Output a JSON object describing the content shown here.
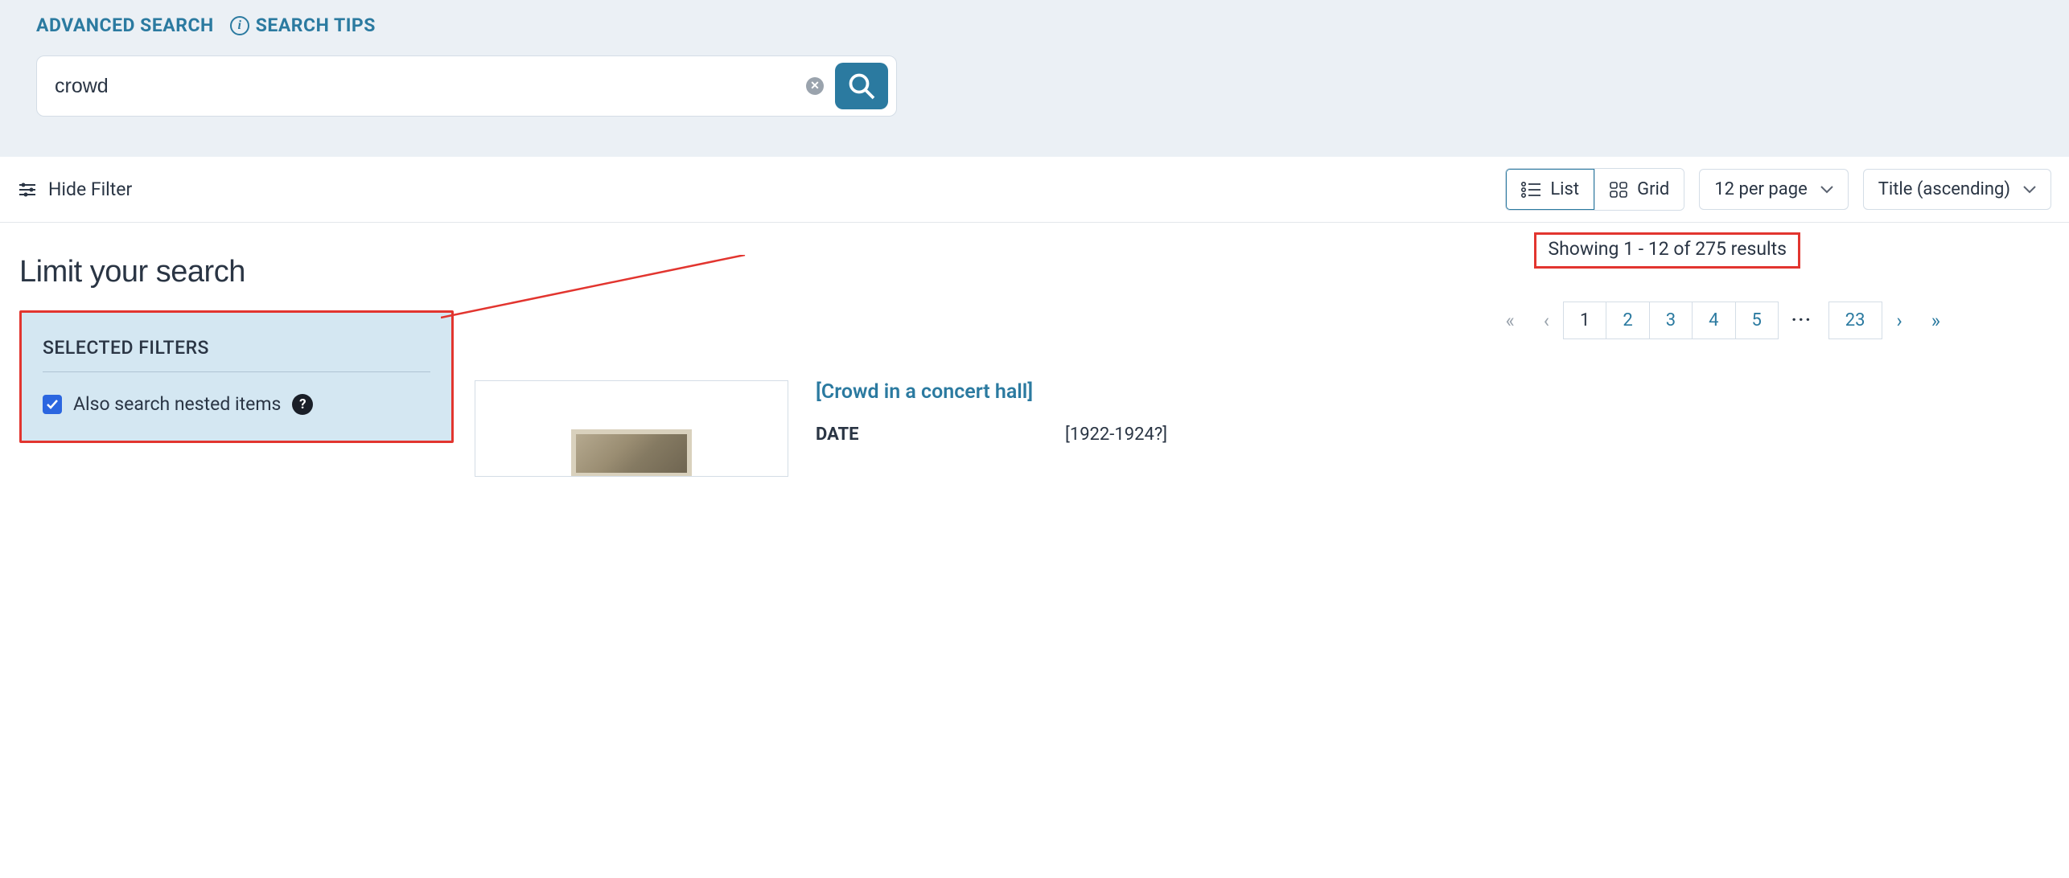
{
  "header": {
    "advanced_search": "ADVANCED SEARCH",
    "search_tips": "SEARCH TIPS"
  },
  "search": {
    "value": "crowd",
    "placeholder": ""
  },
  "toolbar": {
    "hide_filter": "Hide Filter",
    "view_list": "List",
    "view_grid": "Grid",
    "per_page": "12 per page",
    "sort": "Title (ascending)"
  },
  "sidebar": {
    "heading": "Limit your search",
    "selected_filters_heading": "SELECTED FILTERS",
    "nested_label": "Also search nested items"
  },
  "results": {
    "showing_text": "Showing 1 - 12 of 275 results",
    "pages": [
      "1",
      "2",
      "3",
      "4",
      "5"
    ],
    "last_page": "23",
    "item": {
      "title": "[Crowd in a concert hall]",
      "date_key": "DATE",
      "date_val": "[1922-1924?]"
    }
  }
}
